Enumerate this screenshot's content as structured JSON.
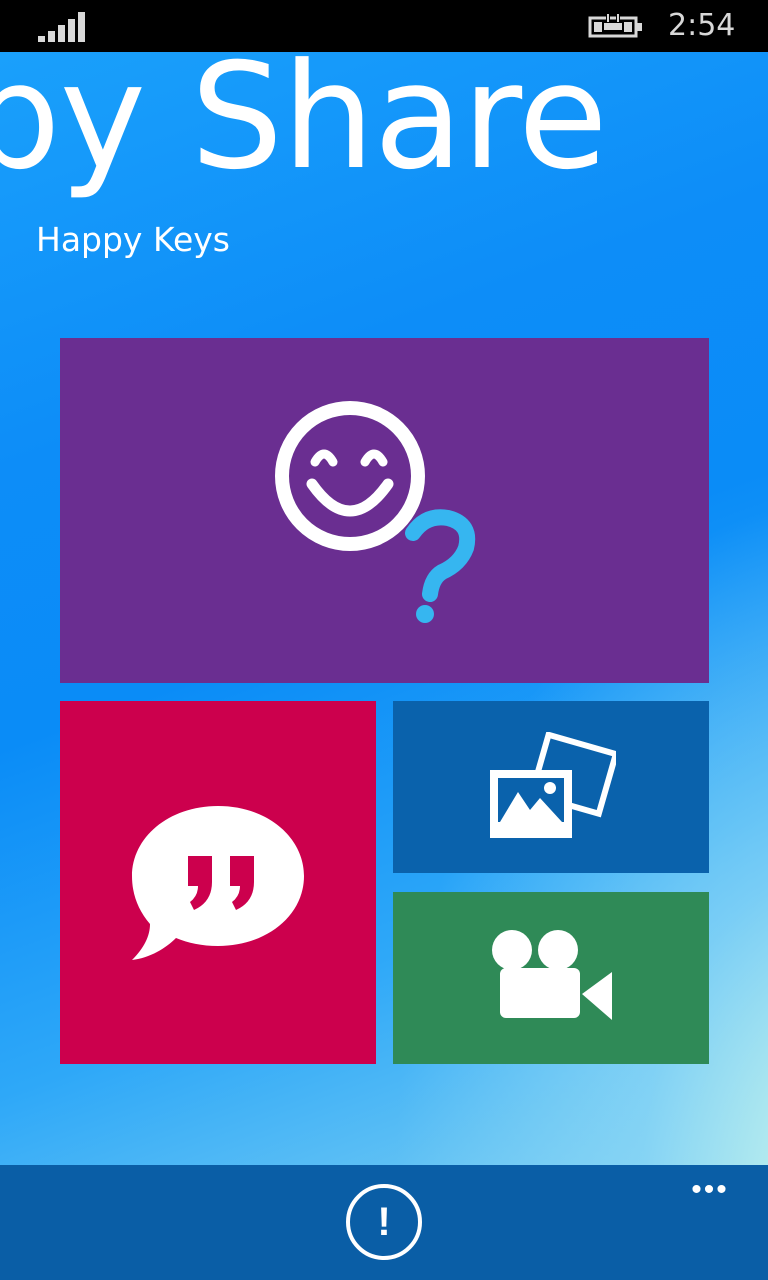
{
  "status_bar": {
    "signal_icon": "signal-strength-icon",
    "battery_icon": "battery-charging-icon",
    "time": "2:54"
  },
  "header": {
    "app_title": "py Share",
    "subtitle": "Happy Keys"
  },
  "tiles": [
    {
      "name": "happy-keys",
      "icon": "smiley-question-icon",
      "color": "#6a2e91"
    },
    {
      "name": "share-text",
      "icon": "quote-bubble-icon",
      "color": "#cc004d"
    },
    {
      "name": "share-photos",
      "icon": "photos-icon",
      "color": "#0a62ac"
    },
    {
      "name": "share-videos",
      "icon": "video-camera-icon",
      "color": "#2f8a57"
    }
  ],
  "app_bar": {
    "about_glyph": "!",
    "about_icon": "exclamation-circle-icon",
    "more_label": "•••",
    "color": "#0a5ea6"
  },
  "colors": {
    "background_accent": "#0a8cf7",
    "question_mark": "#36b6f0"
  }
}
